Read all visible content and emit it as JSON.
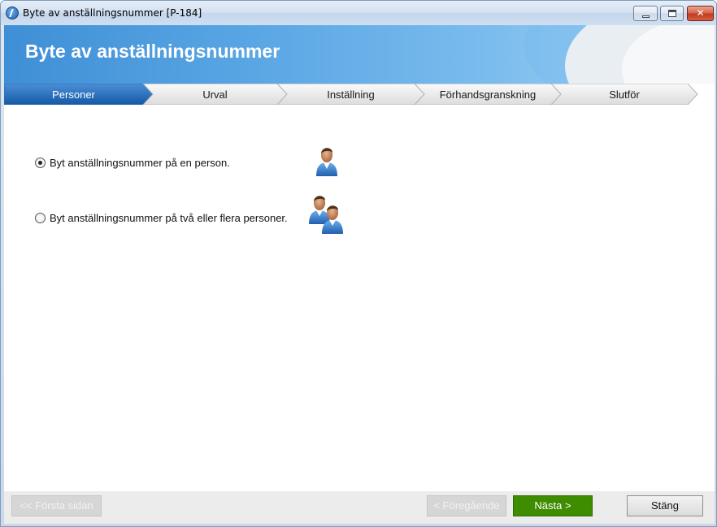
{
  "window": {
    "title": "Byte av anställningsnummer [P-184]",
    "controls": {
      "minimize_icon": "minimize-icon",
      "maximize_icon": "maximize-icon",
      "close_icon": "close-icon",
      "close_glyph": "✕"
    }
  },
  "banner": {
    "title": "Byte av anställningsnummer"
  },
  "steps": [
    {
      "label": "Personer",
      "active": true
    },
    {
      "label": "Urval",
      "active": false
    },
    {
      "label": "Inställning",
      "active": false
    },
    {
      "label": "Förhandsgranskning",
      "active": false
    },
    {
      "label": "Slutför",
      "active": false
    }
  ],
  "options": [
    {
      "label": "Byt anställningsnummer på en person.",
      "checked": true,
      "icon": "single-person-icon"
    },
    {
      "label": "Byt anställningsnummer på två eller flera personer.",
      "checked": false,
      "icon": "multiple-persons-icon"
    }
  ],
  "footer": {
    "first_label": "<< Första sidan",
    "prev_label": "< Föregående",
    "next_label": "Nästa >",
    "close_label": "Stäng"
  },
  "colors": {
    "accent_blue": "#1e66b4",
    "next_green": "#3e8c00",
    "banner_blue": "#5aa6e4"
  }
}
